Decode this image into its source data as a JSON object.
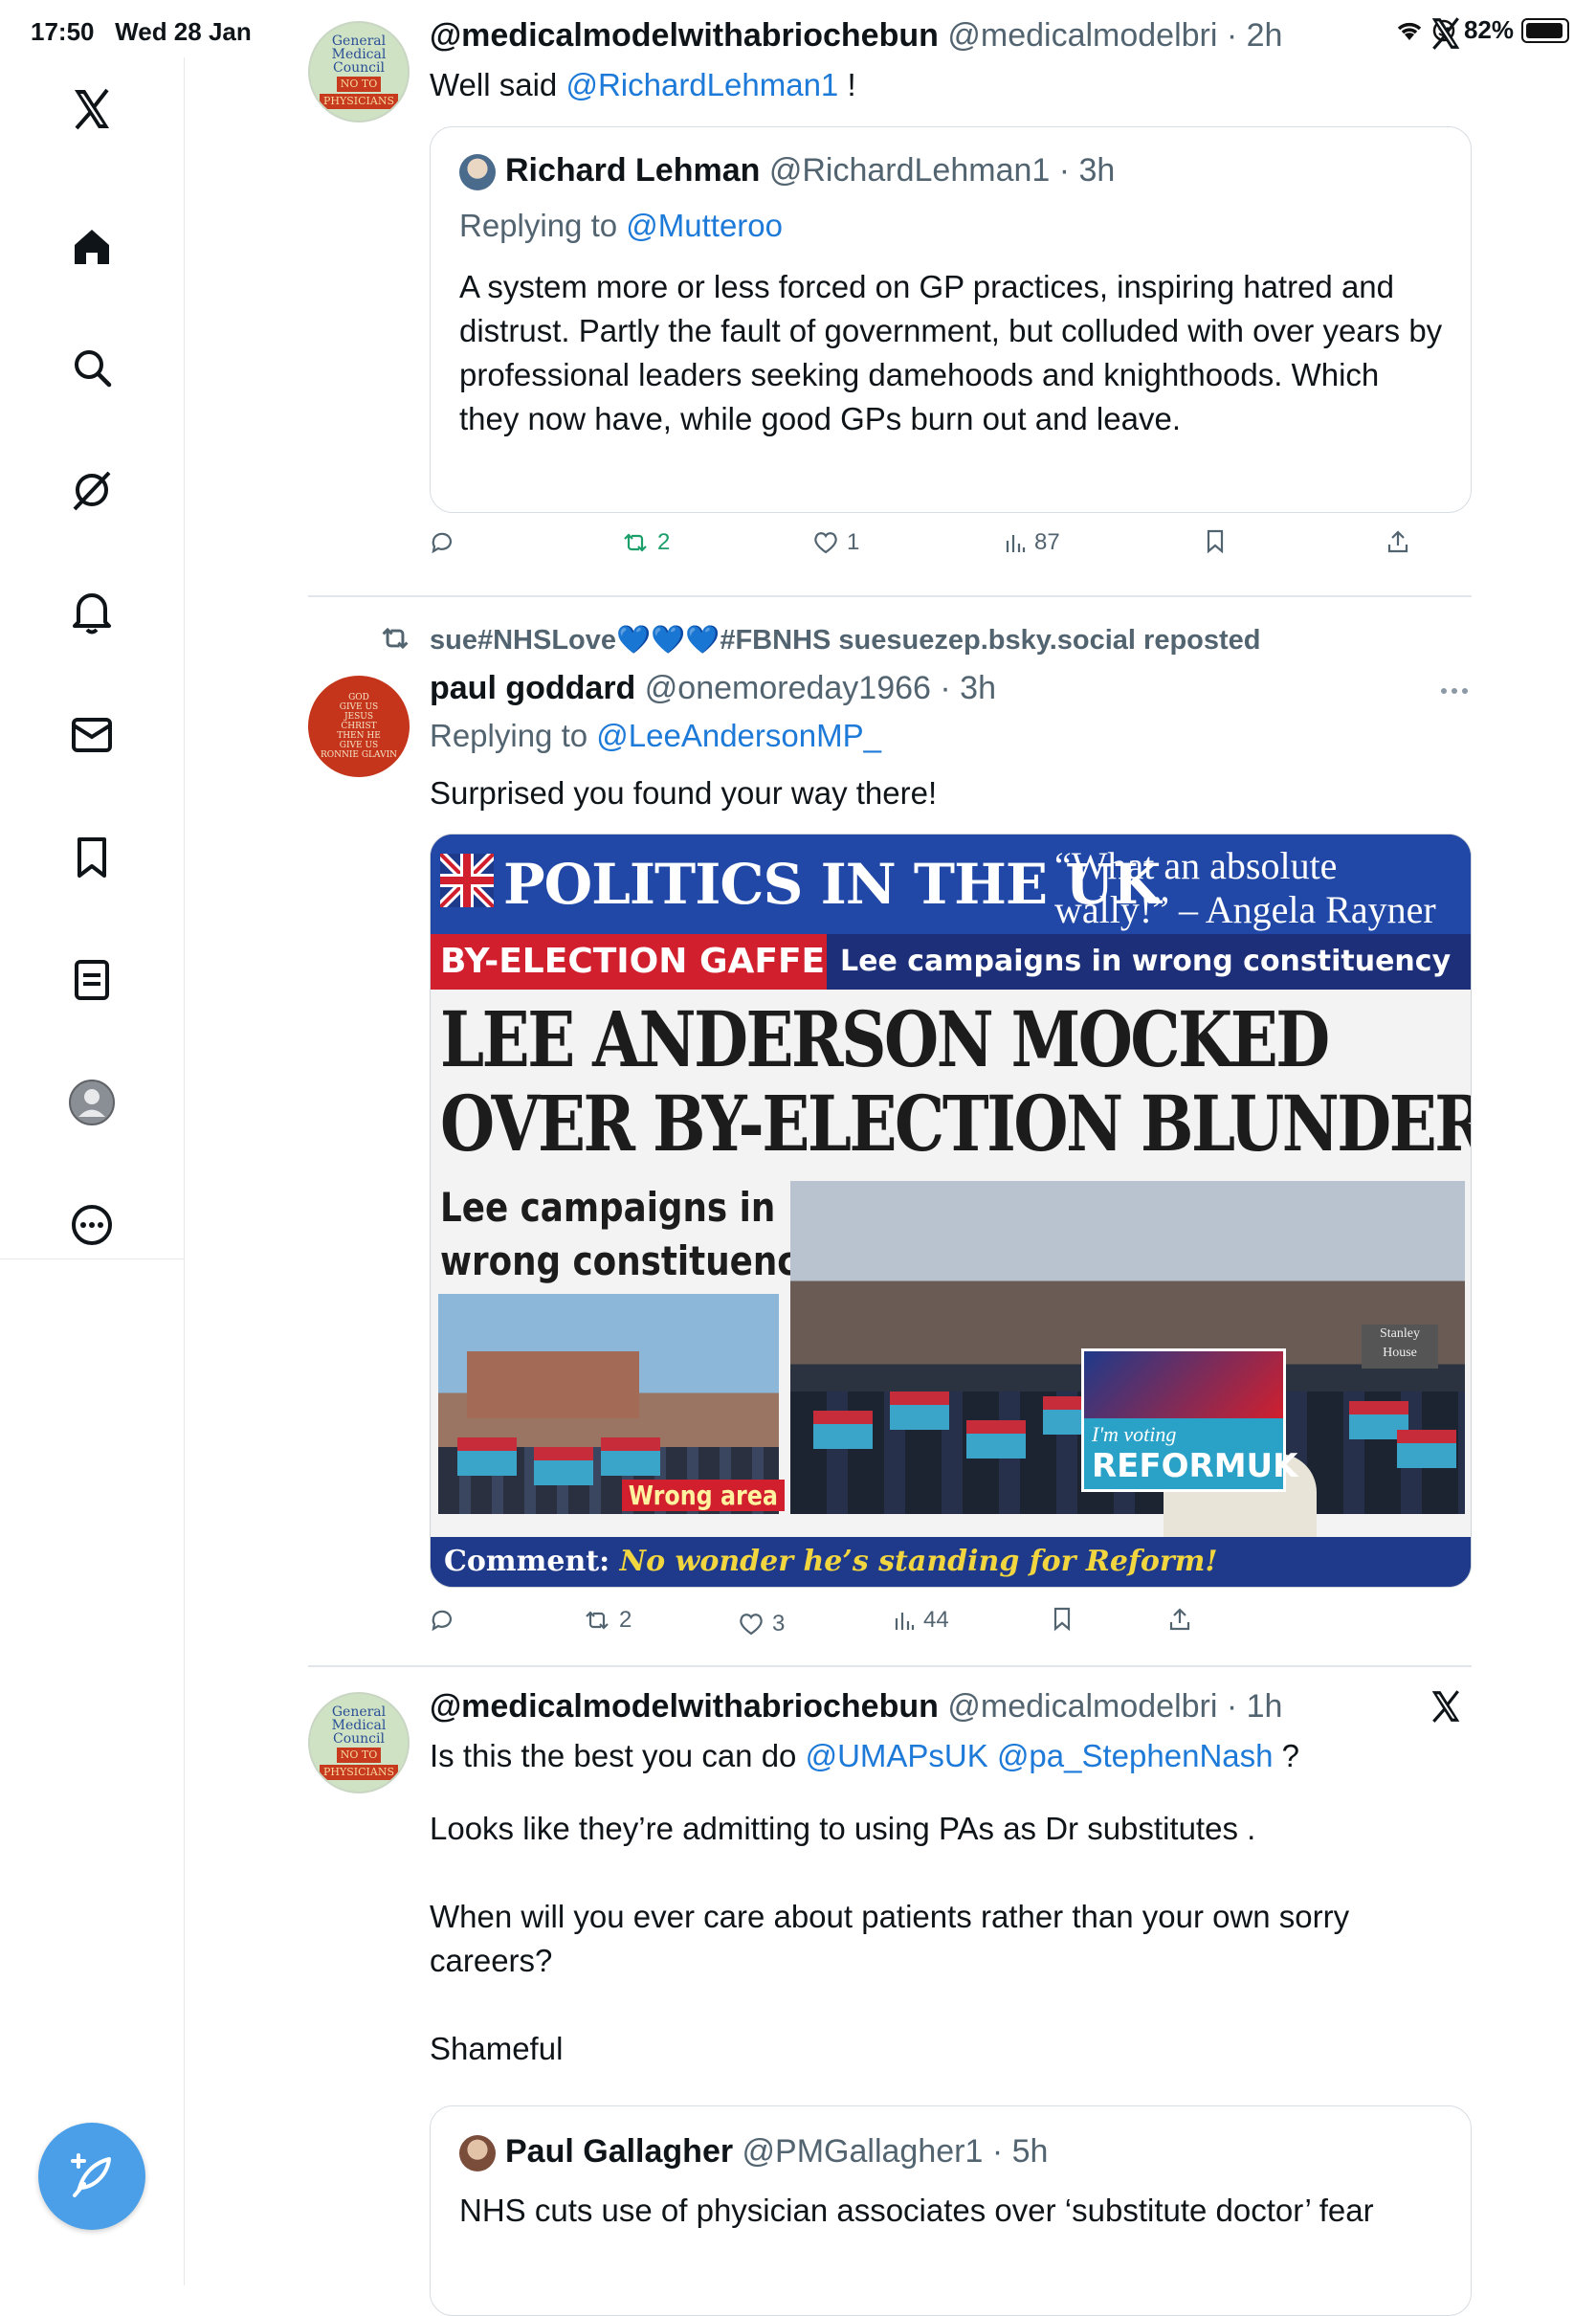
{
  "status": {
    "time": "17:50",
    "date": "Wed 28 Jan",
    "battery": "82%"
  },
  "sidebar": {
    "items": [
      {
        "name": "x-logo"
      },
      {
        "name": "home"
      },
      {
        "name": "search"
      },
      {
        "name": "grok"
      },
      {
        "name": "notifications"
      },
      {
        "name": "messages"
      },
      {
        "name": "bookmarks"
      },
      {
        "name": "lists"
      },
      {
        "name": "profile"
      },
      {
        "name": "more"
      }
    ]
  },
  "tweet1": {
    "author_name": "@medicalmodelwithabriochebun",
    "author_handle": "@medicalmodelbri",
    "time": "2h",
    "text_prefix": "Well said ",
    "mention": "@RichardLehman1",
    "text_suffix": " !",
    "avatar_lines": [
      "General",
      "Medical",
      "Council",
      "NO TO",
      "PHYSICIANS"
    ],
    "quote": {
      "author_name": "Richard Lehman",
      "author_handle": "@RichardLehman1",
      "time": "3h",
      "replying_label": "Replying to ",
      "replying_to": "@Mutteroo",
      "text": "A system more or less forced on GP practices, inspiring hatred and distrust. Partly the fault of government, but colluded with over years by professional leaders seeking damehoods and knighthoods. Which they now have, while good GPs burn out and leave."
    },
    "actions": {
      "reposts": "2",
      "likes": "1",
      "views": "87"
    }
  },
  "tweet2": {
    "repost_label": "sue#NHSLove💙💙💙#FBNHS suesuezep.bsky.social reposted",
    "author_name": "paul goddard",
    "author_handle": "@onemoreday1966",
    "time": "3h",
    "replying_label": "Replying to ",
    "replying_to": "@LeeAndersonMP_",
    "text": "Surprised you found your way there!",
    "avatar_lines": [
      "GOD",
      "GIVE US",
      "JESUS",
      "CHRIST",
      "THEN HE",
      "GIVE US",
      "RONNIE GLAVIN"
    ],
    "image": {
      "banner": "POLITICS IN THE UK",
      "quote": "“What an absolute wally!” – Angela Rayner",
      "tag": "BY-ELECTION GAFFE",
      "tag_text": "Lee campaigns in wrong constituency",
      "headline_1": "LEE ANDERSON MOCKED",
      "headline_2": "OVER BY-ELECTION BLUNDER",
      "sub_1": "Lee campaigns in",
      "sub_2": "wrong constituency",
      "wrong_area": "Wrong area",
      "sign_small": "I'm voting",
      "sign_brand": "REFORMUK",
      "building_sign": "Stanley House",
      "comment_label": "Comment:",
      "comment_text": "No wonder he’s standing for Reform!"
    },
    "actions": {
      "reposts": "2",
      "likes": "3",
      "views": "44"
    }
  },
  "tweet3": {
    "author_name": "@medicalmodelwithabriochebun",
    "author_handle": "@medicalmodelbri",
    "time": "1h",
    "line1_prefix": "Is this the best you can do ",
    "mention1": "@UMAPsUK",
    "mention2": "@pa_StephenNash",
    "line1_suffix": " ?",
    "para2": "Looks like they’re  admitting to using PAs as Dr substitutes .",
    "para3": "When will you ever care about patients rather than your own sorry careers?",
    "para4": "Shameful",
    "quote": {
      "author_name": "Paul Gallagher",
      "author_handle": "@PMGallagher1",
      "time": "5h",
      "text": "NHS cuts use of physician associates over ‘substitute doctor’ fear"
    }
  },
  "colors": {
    "link": "#1d7ad8",
    "repost_green": "#1a9e6a",
    "compose": "#4a9fe8"
  }
}
